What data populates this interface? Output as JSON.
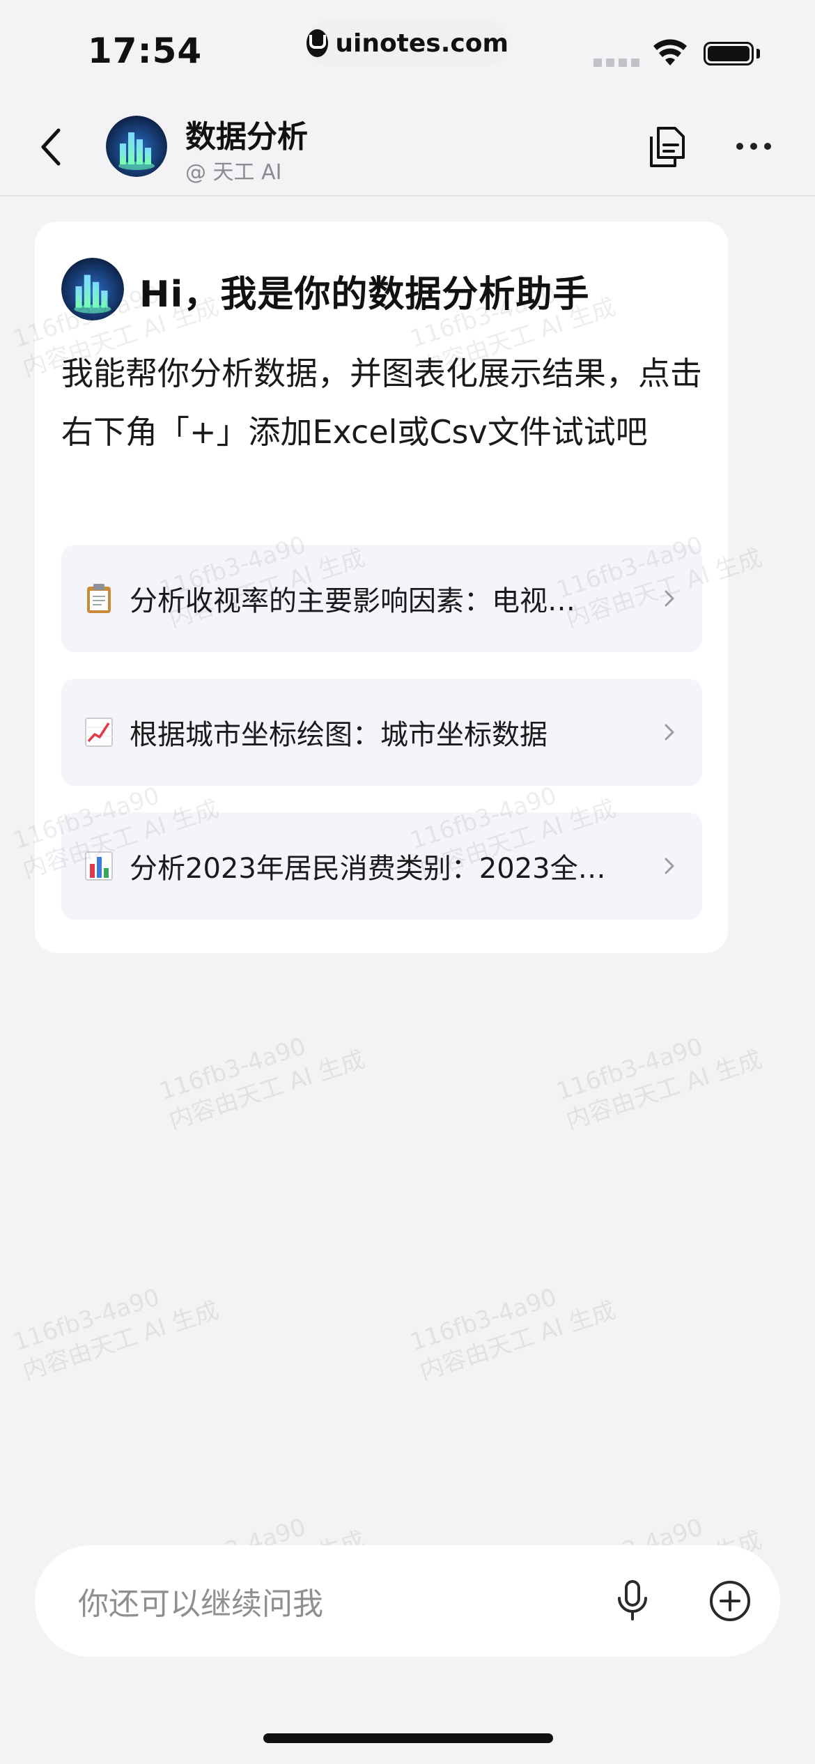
{
  "status_bar": {
    "time": "17:54",
    "url": "uinotes.com"
  },
  "header": {
    "title": "数据分析",
    "subtitle": "@ 天工 AI"
  },
  "card": {
    "greeting": "Hi，我是你的数据分析助手",
    "intro": "我能帮你分析数据，并图表化展示结果，点击右下角「+」添加Excel或Csv文件试试吧",
    "suggestions": [
      {
        "icon": "clipboard-emoji",
        "label": "分析收视率的主要影响因素：电视…"
      },
      {
        "icon": "chart-increasing-emoji",
        "label": "根据城市坐标绘图：城市坐标数据"
      },
      {
        "icon": "bar-chart-emoji",
        "label": "分析2023年居民消费类别：2023全…"
      }
    ]
  },
  "watermark": {
    "line1": "116fb3-4a90",
    "line2": "内容由天工 AI 生成"
  },
  "input": {
    "placeholder": "你还可以继续问我"
  },
  "colors": {
    "background": "#f3f3f5",
    "card": "#ffffff",
    "suggestion_bg": "#f4f5fb",
    "placeholder": "#8e8e93"
  }
}
